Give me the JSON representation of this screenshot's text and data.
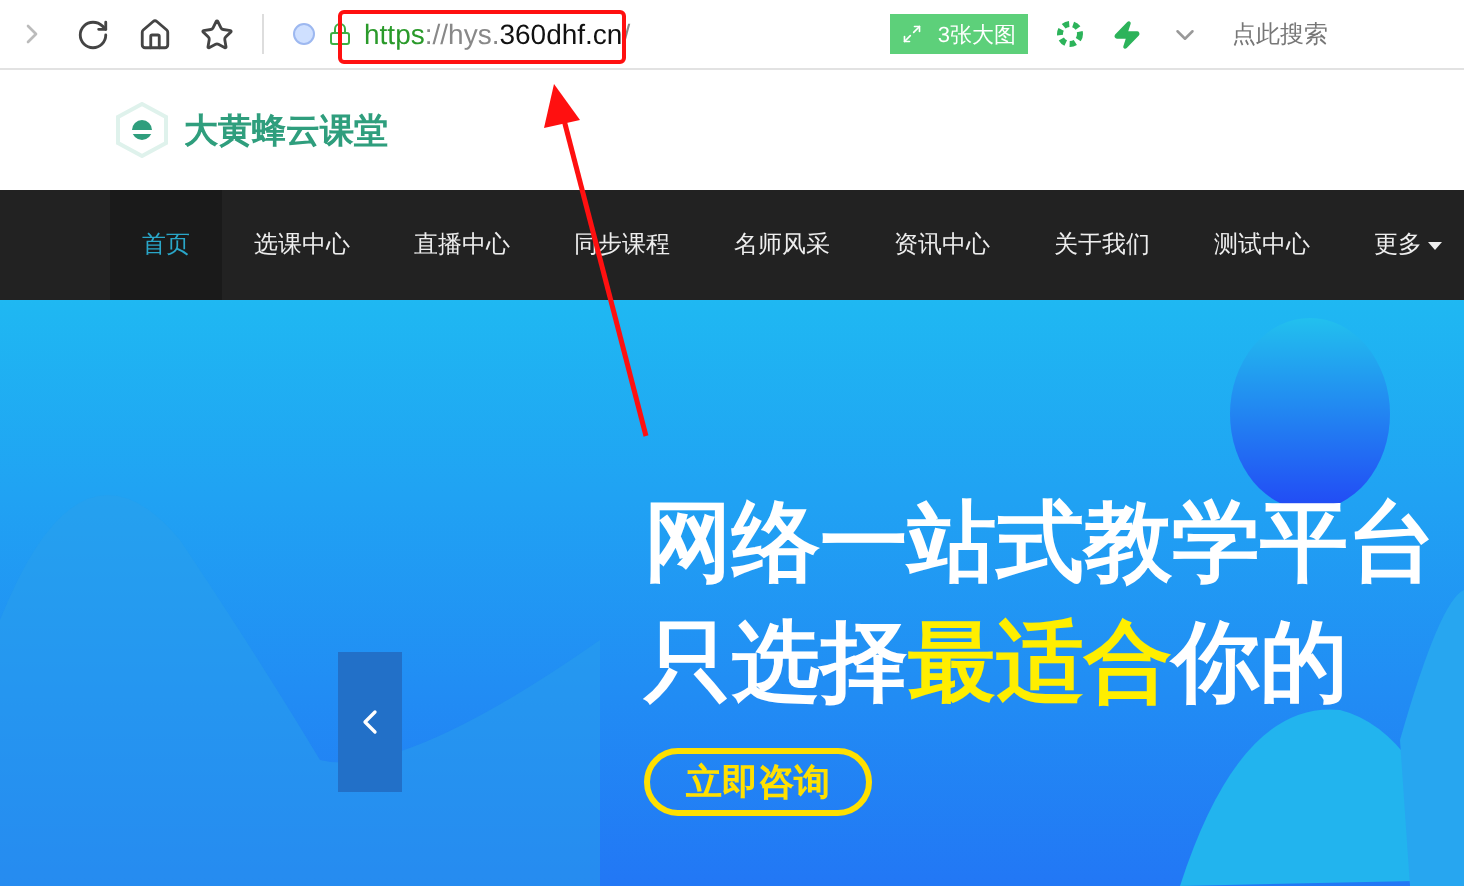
{
  "browser": {
    "url_parts": [
      {
        "kind": "scheme",
        "text": "https"
      },
      {
        "kind": "muted",
        "text": "://hys."
      },
      {
        "kind": "domain",
        "text": "360dhf.cn"
      },
      {
        "kind": "muted",
        "text": "/"
      }
    ],
    "images_button": "3张大图",
    "search": {
      "placeholder": "点此搜索"
    }
  },
  "header": {
    "logo_text": "大黄蜂云课堂"
  },
  "nav": {
    "items": [
      {
        "label": "首页",
        "selected": true
      },
      {
        "label": "选课中心",
        "selected": false
      },
      {
        "label": "直播中心",
        "selected": false
      },
      {
        "label": "同步课程",
        "selected": false
      },
      {
        "label": "名师风采",
        "selected": false
      },
      {
        "label": "资讯中心",
        "selected": false
      },
      {
        "label": "关于我们",
        "selected": false
      },
      {
        "label": "测试中心",
        "selected": false
      },
      {
        "label": "更多",
        "selected": false,
        "kind": "dropdown"
      }
    ]
  },
  "hero": {
    "headline": "网络一站式教学平台",
    "subline": [
      {
        "text": "只选择",
        "highlight": false
      },
      {
        "text": "最适合",
        "highlight": true
      },
      {
        "text": "你的",
        "highlight": false
      }
    ],
    "cta": "立即咨询"
  }
}
